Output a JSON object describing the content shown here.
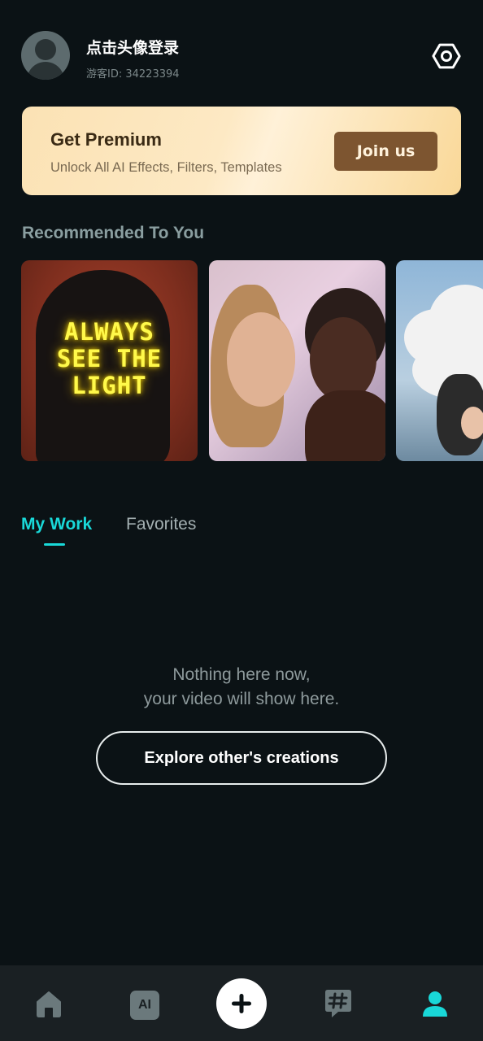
{
  "user": {
    "name": "点击头像登录",
    "guest_id": "游客ID: 34223394"
  },
  "premium": {
    "title": "Get Premium",
    "subtitle": "Unlock All AI Effects, Filters, Templates",
    "button_label": "Join us"
  },
  "recommended": {
    "title": "Recommended To You",
    "cards": [
      {
        "icon": "neon-sign-portrait",
        "neon_text": [
          "ALWAYS",
          "SEE THE",
          "LIGHT"
        ]
      },
      {
        "icon": "two-women-portrait"
      },
      {
        "icon": "cloud-head-portrait"
      }
    ]
  },
  "tabs": {
    "my_work": "My Work",
    "favorites": "Favorites",
    "active": "My Work"
  },
  "empty_state": {
    "line1": "Nothing here now,",
    "line2": "your video will show here.",
    "button_label": "Explore other's creations"
  },
  "bottom_nav": {
    "items": [
      {
        "icon": "home-icon",
        "active": false
      },
      {
        "icon": "ai-icon",
        "label": "AI",
        "active": false
      },
      {
        "icon": "plus-icon",
        "active": false
      },
      {
        "icon": "hashtag-icon",
        "active": false
      },
      {
        "icon": "profile-icon",
        "active": true
      }
    ]
  },
  "colors": {
    "background": "#0b1215",
    "accent": "#19d8d8",
    "premium_button": "#7d5530",
    "nav_background": "#1a2023"
  }
}
